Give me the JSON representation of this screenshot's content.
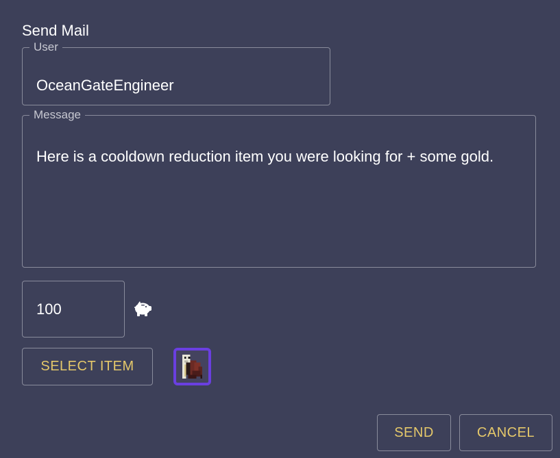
{
  "dialog": {
    "title": "Send Mail"
  },
  "user": {
    "label": "User",
    "value": "OceanGateEngineer"
  },
  "message": {
    "label": "Message",
    "value": "Here is a cooldown reduction item you were looking for + some gold."
  },
  "gold": {
    "value": "100",
    "icon": "piggy-bank-icon"
  },
  "item": {
    "select_label": "SELECT ITEM",
    "icon": "cloak-item-icon",
    "border_color": "#6a3fe0"
  },
  "actions": {
    "send_label": "SEND",
    "cancel_label": "CANCEL"
  },
  "colors": {
    "background": "#3d4059",
    "accent": "#e5c86a",
    "border": "#8a8c9c"
  }
}
